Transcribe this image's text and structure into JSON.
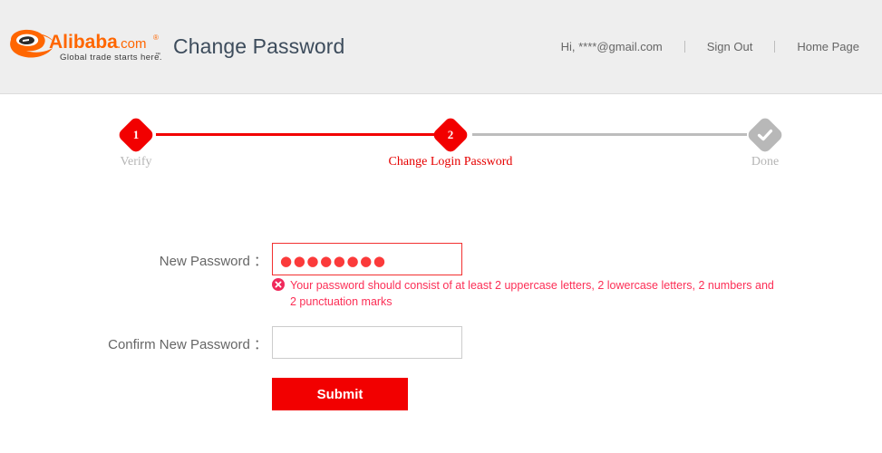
{
  "header": {
    "logo": {
      "brand": "Alibaba",
      "domain": ".com",
      "tagline": "Global trade starts here.",
      "trademark": "™",
      "registered": "®",
      "brand_color": "#f60",
      "brand_text_color": "#f60"
    },
    "title": "Change Password",
    "title_color": "#3d4c5c",
    "background_color": "#eeeeee",
    "links": {
      "greeting": "Hi, ****@gmail.com",
      "sign_out": "Sign Out",
      "home_page": "Home Page"
    }
  },
  "steps": {
    "accent_color": "#f20000",
    "inactive_color": "#b8b8b8",
    "items": [
      {
        "number": "1",
        "label": "Verify",
        "state": "completed"
      },
      {
        "number": "2",
        "label": "Change Login Password",
        "state": "current"
      },
      {
        "number": "",
        "label": "Done",
        "state": "pending",
        "icon": "check-icon"
      }
    ]
  },
  "form": {
    "new_password": {
      "label": "New Password ：",
      "value": "●●●●●●●●",
      "placeholder": "",
      "has_error": true
    },
    "error": {
      "icon": "error-circle-x-icon",
      "message": "Your password should consist of at least 2 uppercase letters, 2 lowercase letters, 2 numbers and 2 punctuation marks",
      "color": "#fc2f56"
    },
    "confirm_password": {
      "label": "Confirm New Password ：",
      "value": "",
      "placeholder": ""
    },
    "submit": {
      "label": "Submit",
      "color": "#f20000"
    }
  }
}
